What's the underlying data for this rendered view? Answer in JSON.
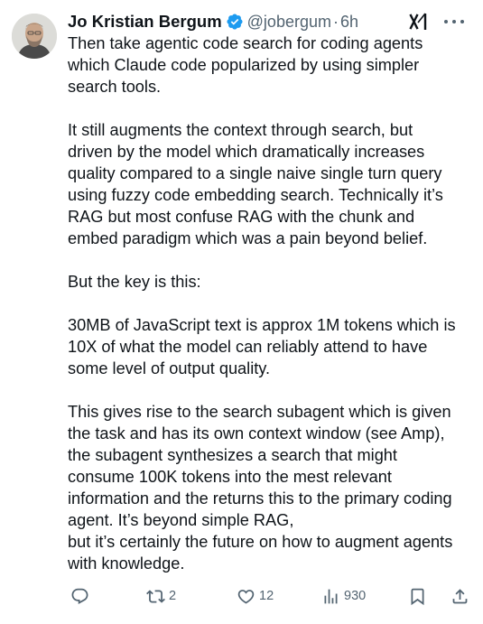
{
  "author": {
    "display_name": "Jo Kristian Bergum",
    "handle": "@jobergum",
    "separator": "·",
    "timestamp": "6h",
    "verified": true,
    "verified_color": "#1d9bf0"
  },
  "tweet": {
    "paragraphs": [
      [
        "Then take agentic code search for coding agents",
        "which Claude code popularized by using simpler",
        "search tools."
      ],
      [
        "It still augments the context through search, but",
        "driven by the model which dramatically increases",
        "quality compared to a single naive single turn query",
        "using fuzzy code embedding search. Technically it’s",
        "RAG but most confuse RAG with the chunk and",
        "embed paradigm which was a pain beyond belief."
      ],
      [
        "But the key is this:"
      ],
      [
        "30MB of JavaScript text is approx 1M tokens which is",
        "10X of what the model can reliably attend to have",
        "some level of output quality."
      ],
      [
        "This gives rise to the search subagent which is given",
        "the task and has its own context window (see Amp),",
        "the subagent synthesizes a search that might",
        "consume 100K tokens into the mest relevant",
        "information and the returns this to the primary coding",
        "agent. It’s beyond simple RAG,",
        "but it’s certainly the future on how to augment agents",
        "with knowledge."
      ]
    ]
  },
  "actions": {
    "reply": {
      "icon": "reply-icon",
      "count": ""
    },
    "repost": {
      "icon": "repost-icon",
      "count": "2"
    },
    "like": {
      "icon": "heart-icon",
      "count": "12"
    },
    "views": {
      "icon": "views-icon",
      "count": "930"
    },
    "bookmark": {
      "icon": "bookmark-icon",
      "count": ""
    },
    "share": {
      "icon": "share-icon",
      "count": ""
    }
  },
  "colors": {
    "text_primary": "#0f1419",
    "text_secondary": "#536471",
    "background": "#ffffff"
  }
}
